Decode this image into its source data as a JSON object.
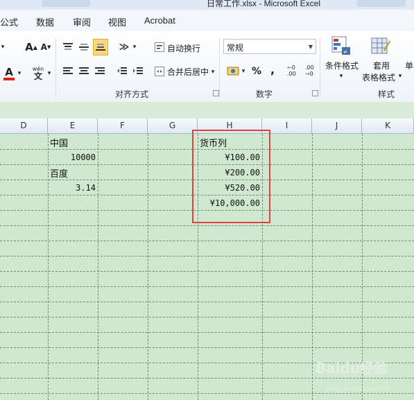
{
  "window": {
    "title": "日常工作.xlsx - Microsoft Excel"
  },
  "menu": [
    "公式",
    "数据",
    "审阅",
    "视图",
    "Acrobat"
  ],
  "ribbon": {
    "alignment": {
      "wrap_text_label": "自动换行",
      "merge_center_label": "合并后居中",
      "group_label": "对齐方式"
    },
    "number": {
      "format_value": "常规",
      "percent_symbol": "%",
      "comma_symbol": ",",
      "increase_decimal": ".00",
      "decrease_decimal": ".00",
      "group_label": "数字"
    },
    "styles": {
      "conditional_format_label": "条件格式",
      "table_format_label_1": "套用",
      "table_format_label_2": "表格格式",
      "cell_styles_label": "单",
      "group_label": "样式"
    }
  },
  "sheet": {
    "columns": [
      "D",
      "E",
      "F",
      "G",
      "H",
      "I",
      "J",
      "K"
    ],
    "cells": {
      "E1": "中国",
      "E2": "10000",
      "E3": "百度",
      "E4": "3.14",
      "H1": "货币列",
      "H2": "¥100.00",
      "H3": "¥200.00",
      "H4": "¥520.00",
      "H5": "¥10,000.00"
    }
  },
  "colors": {
    "sheet_background": "#cfe8cf",
    "highlight_box": "#e0413a",
    "font_color_swatch": "#e0201a"
  },
  "watermark": {
    "line1": "Baidu经验",
    "line2": "jingyan.baidu.com"
  }
}
